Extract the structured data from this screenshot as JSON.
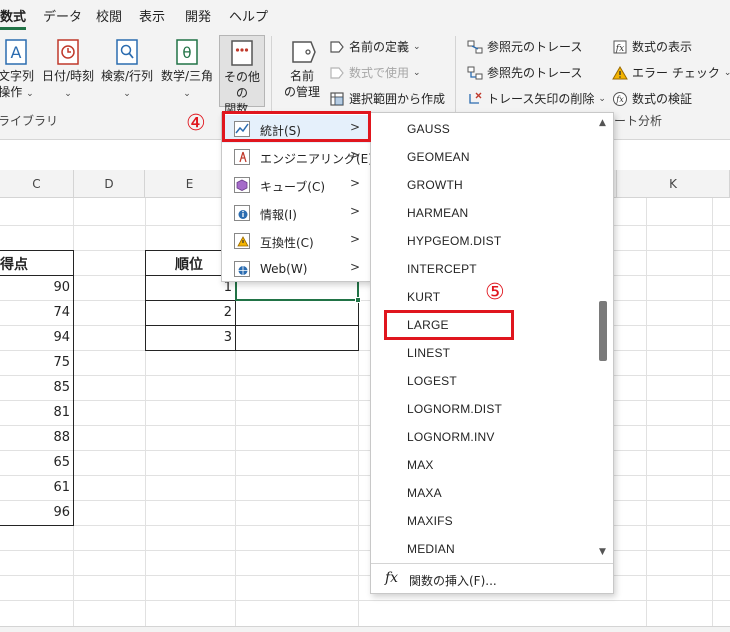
{
  "tabs": [
    "数式",
    "データ",
    "校閲",
    "表示",
    "開発",
    "ヘルプ"
  ],
  "ribbon": {
    "func_lib_buttons": [
      {
        "line1": "文字列",
        "line2": "操作"
      },
      {
        "line1": "日付/時刻",
        "line2": ""
      },
      {
        "line1": "検索/行列",
        "line2": ""
      },
      {
        "line1": "数学/三角",
        "line2": ""
      },
      {
        "line1": "その他の",
        "line2": "関数"
      }
    ],
    "func_lib_label": "ライブラリ",
    "name_manager": {
      "line1": "名前",
      "line2": "の管理"
    },
    "define_name": "名前の定義",
    "use_in_formula": "数式で使用",
    "create_from_selection": "選択範囲から作成",
    "trace_precedents": "参照元のトレース",
    "trace_dependents": "参照先のトレース",
    "remove_arrows": "トレース矢印の削除",
    "show_formulas": "数式の表示",
    "error_checking": "エラー チェック",
    "evaluate_formula": "数式の検証",
    "audit_label": "ート分析",
    "colors": {
      "accent": "#217346",
      "highlight": "#e0161e"
    }
  },
  "grid": {
    "columns": [
      "C",
      "D",
      "E",
      "",
      "K"
    ],
    "header_score": "得点",
    "scores": [
      "90",
      "74",
      "94",
      "75",
      "85",
      "81",
      "88",
      "65",
      "61",
      "96"
    ],
    "header_rank": "順位",
    "ranks": [
      "1",
      "2",
      "3"
    ]
  },
  "submenu": {
    "items": [
      {
        "label": "統計(S)",
        "icon": "chart-line-icon"
      },
      {
        "label": "エンジニアリング(E)",
        "icon": "engineering-icon"
      },
      {
        "label": "キューブ(C)",
        "icon": "cube-icon"
      },
      {
        "label": "情報(I)",
        "icon": "info-icon"
      },
      {
        "label": "互換性(C)",
        "icon": "warning-icon"
      },
      {
        "label": "Web(W)",
        "icon": "web-icon"
      }
    ]
  },
  "functions": [
    "GAUSS",
    "GEOMEAN",
    "GROWTH",
    "HARMEAN",
    "HYPGEOM.DIST",
    "INTERCEPT",
    "KURT",
    "LARGE",
    "LINEST",
    "LOGEST",
    "LOGNORM.DIST",
    "LOGNORM.INV",
    "MAX",
    "MAXA",
    "MAXIFS",
    "MEDIAN"
  ],
  "insert_function": {
    "fx": "fx",
    "label": "関数の挿入(F)..."
  },
  "annotations": {
    "step4": "④",
    "step5": "⑤"
  }
}
